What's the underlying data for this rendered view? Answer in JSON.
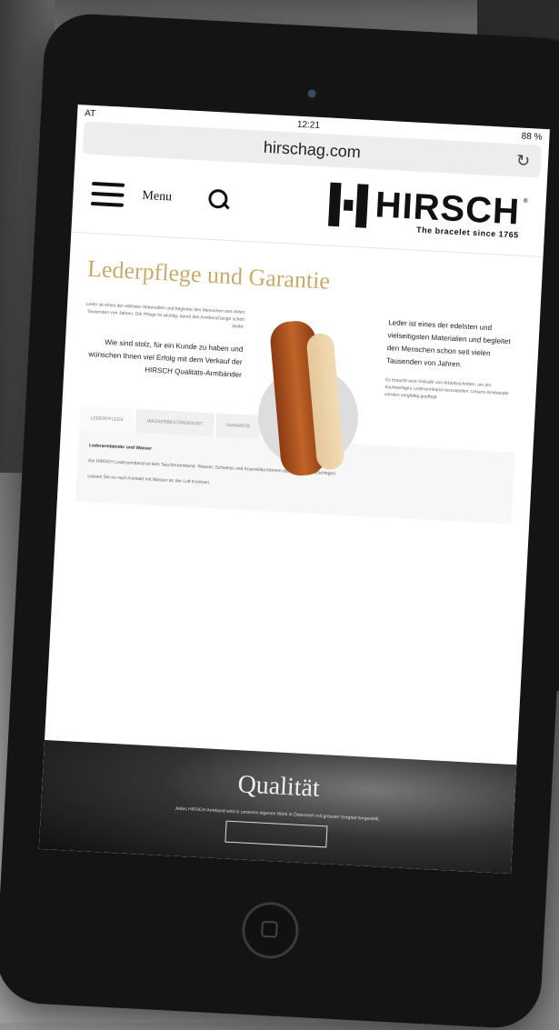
{
  "status": {
    "carrier": "AT",
    "time": "12:21",
    "battery": "88 %"
  },
  "browser": {
    "url": "hirschag.com"
  },
  "header": {
    "menu_label": "Menu",
    "brand": "HIRSCH",
    "tagline": "The bracelet since 1765"
  },
  "page": {
    "title": "Lederpflege und Garantie",
    "intro_small": "Leder ist eines der edelsten Materialien und begleitet den Menschen seit vielen Tausenden von Jahren. Die Pflege ist wichtig, damit das Armband lange schön bleibt.",
    "intro_bold": "Wie sind stolz, für ein Kunde zu haben und wünschen Ihnen viel Erfolg mit dem Verkauf der HIRSCH Qualitäts-Armbänder",
    "right_bold": "Leder ist eines der edelsten und vielseitigsten Materialien und begleitet den Menschen schon seit vielen Tausenden von Jahren.",
    "right_small": "Es braucht eine Vielzahl von Arbeitsschritten, um ein hochwertiges Lederarmband herzustellen. Unsere Armbänder werden sorgfältig gepflegt."
  },
  "tabs": [
    "LEDERPFLEGE",
    "WASSERBESTÄNDIGKEIT",
    "GARANTIE"
  ],
  "tab_panel": {
    "heading": "Lederarmbänder und Wasser",
    "p1": "Ein HIRSCH Lederarmband ist kein Taucherarmband. Wasser, Schweiss und Kosmetika können das Leder beeinträchtigen.",
    "p2": "Lassen Sie es nach Kontakt mit Wasser an der Luft trocknen."
  },
  "hero": {
    "title": "Qualität",
    "text": "Jedes HIRSCH Armband wird in unserem eigenen Werk in Österreich mit grösster Sorgfalt hergestellt."
  }
}
